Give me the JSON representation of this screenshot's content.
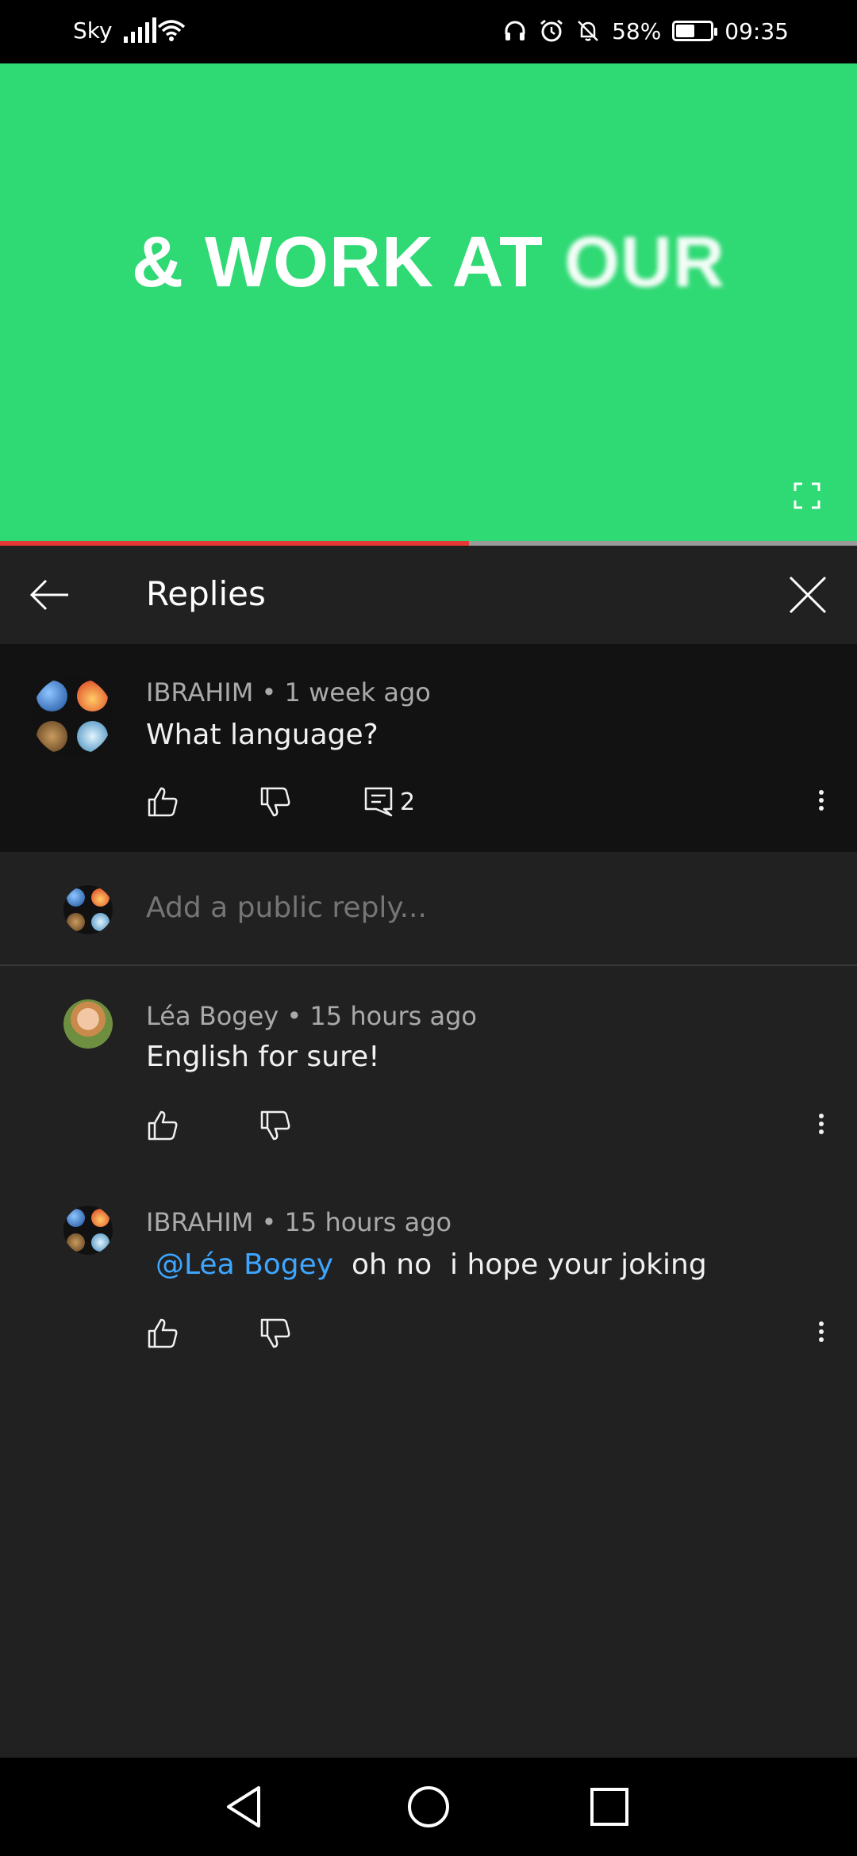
{
  "status_bar": {
    "carrier": "Sky",
    "battery_percent": "58%",
    "battery_level": 0.58,
    "time": "09:35"
  },
  "video": {
    "caption_main": "& WORK AT ",
    "caption_fading": "OUR",
    "progress": 0.547,
    "background_color": "#2fd974"
  },
  "replies_header": {
    "title": "Replies"
  },
  "parent_comment": {
    "author": "IBRAHIM",
    "time": "1 week ago",
    "text": "What language?",
    "reply_count": "2"
  },
  "add_reply": {
    "placeholder": "Add a public reply..."
  },
  "replies": [
    {
      "author": "Léa Bogey",
      "time": "15 hours ago",
      "text": "English for sure!"
    },
    {
      "author": "IBRAHIM",
      "time": "15 hours ago",
      "mention": "@Léa Bogey",
      "text": "oh no  i hope your joking"
    }
  ],
  "separator": " • ",
  "colors": {
    "accent_link": "#3ea6ff",
    "progress_played": "#e53935"
  }
}
